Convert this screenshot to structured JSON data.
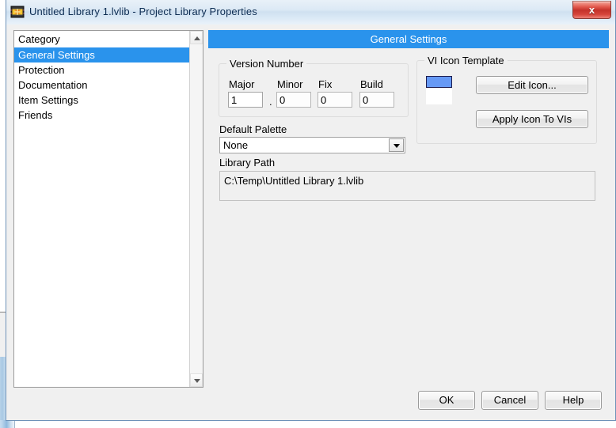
{
  "window": {
    "title": "Untitled Library 1.lvlib - Project Library Properties",
    "icon": "labview-library-icon",
    "close_label": "x",
    "accent_color": "#2a93ec",
    "close_color": "#c4322a"
  },
  "category_panel": {
    "header": "Category",
    "items": [
      {
        "label": "General Settings",
        "selected": true
      },
      {
        "label": "Protection",
        "selected": false
      },
      {
        "label": "Documentation",
        "selected": false
      },
      {
        "label": "Item Settings",
        "selected": false
      },
      {
        "label": "Friends",
        "selected": false
      }
    ]
  },
  "content": {
    "banner_title": "General Settings",
    "version_group": {
      "title": "Version Number",
      "separator": ".",
      "fields": [
        {
          "label": "Major",
          "value": "1"
        },
        {
          "label": "Minor",
          "value": "0"
        },
        {
          "label": "Fix",
          "value": "0"
        },
        {
          "label": "Build",
          "value": "0"
        }
      ]
    },
    "icon_group": {
      "title": "VI Icon Template",
      "preview_band_color": "#6699f5",
      "edit_button": "Edit Icon...",
      "apply_button": "Apply Icon To VIs"
    },
    "default_palette": {
      "label": "Default Palette",
      "value": "None",
      "options": [
        "None"
      ]
    },
    "library_path": {
      "label": "Library Path",
      "value": "C:\\Temp\\Untitled Library 1.lvlib"
    }
  },
  "footer": {
    "ok_label": "OK",
    "cancel_label": "Cancel",
    "help_label": "Help"
  }
}
